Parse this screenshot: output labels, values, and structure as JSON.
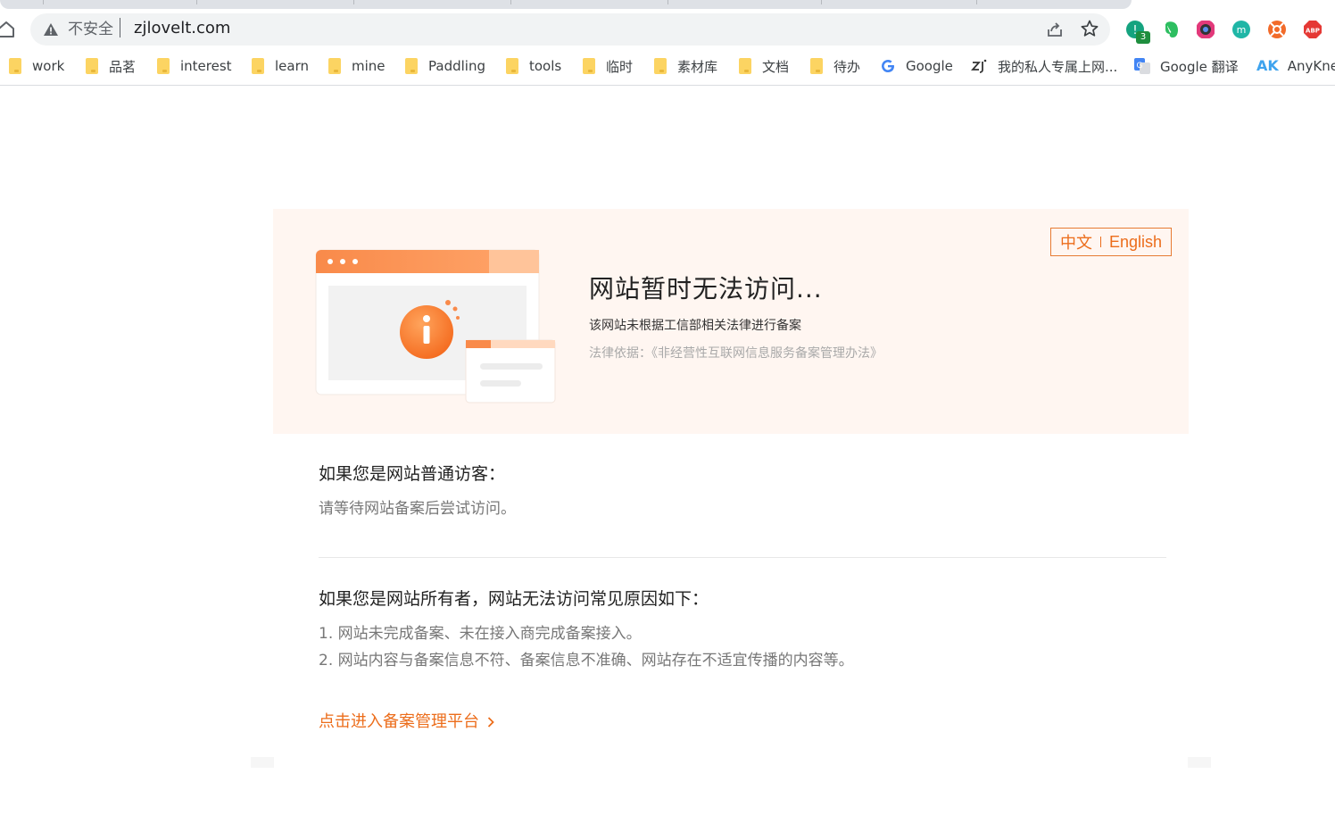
{
  "browser": {
    "security_label": "不安全",
    "url": "zjlovelt.com",
    "extension_badge": "3",
    "bookmarks": [
      {
        "label": "work",
        "icon": "folder-icon"
      },
      {
        "label": "品茗",
        "icon": "folder-icon"
      },
      {
        "label": "interest",
        "icon": "folder-icon"
      },
      {
        "label": "learn",
        "icon": "folder-icon"
      },
      {
        "label": "mine",
        "icon": "folder-icon"
      },
      {
        "label": "Paddling",
        "icon": "folder-icon"
      },
      {
        "label": "tools",
        "icon": "folder-icon"
      },
      {
        "label": "临时",
        "icon": "folder-icon"
      },
      {
        "label": "素材库",
        "icon": "folder-icon"
      },
      {
        "label": "文档",
        "icon": "folder-icon"
      },
      {
        "label": "待办",
        "icon": "folder-icon"
      },
      {
        "label": "Google",
        "icon": "google-icon"
      },
      {
        "label": "我的私人专属上网...",
        "icon": "zj-icon"
      },
      {
        "label": "Google 翻译",
        "icon": "google-translate-icon"
      },
      {
        "label": "AnyKnew",
        "icon": "anyknew-icon",
        "glyph": "AK"
      }
    ],
    "colors": {
      "chrome_bg": "#ffffff",
      "omnibox_bg": "#f1f3f4"
    }
  },
  "page": {
    "lang": {
      "zh": "中文",
      "en": "English"
    },
    "title": "网站暂时无法访问...",
    "subtitle": "该网站未根据工信部相关法律进行备案",
    "law_basis": "法律依据：《非经营性互联网信息服务备案管理办法》",
    "visitor": {
      "heading": "如果您是网站普通访客：",
      "text": "请等待网站备案后尝试访问。"
    },
    "owner": {
      "heading": "如果您是网站所有者，网站无法访问常见原因如下：",
      "reasons": [
        "1. 网站未完成备案、未在接入商完成备案接入。",
        "2. 网站内容与备案信息不符、备案信息不准确、网站存在不适宜传播的内容等。"
      ]
    },
    "platform_link": "点击进入备案管理平台",
    "colors": {
      "accent": "#ec6d1b",
      "banner_bg": "#fff6f1"
    }
  }
}
